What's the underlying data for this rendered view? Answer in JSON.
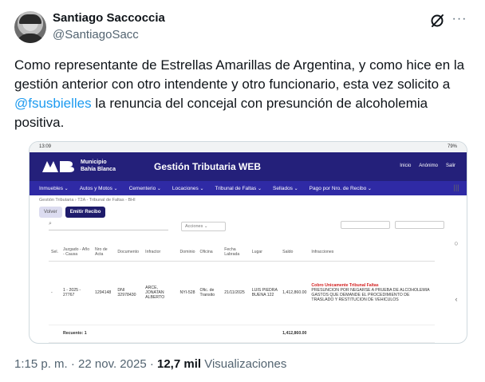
{
  "author": {
    "name": "Santiago Saccoccia",
    "handle": "@SantiagoSacc"
  },
  "tweet": {
    "text_before": "Como representante de Estrellas Amarillas de Argentina,  y como hice en la gestión anterior con otro intendente y otro funcionario, esta vez solicito a ",
    "mention": "@fsusbielles",
    "text_after": " la renuncia del concejal con presunción de alcoholemia positiva."
  },
  "media": {
    "status_time": "13:09",
    "status_right": "79%",
    "brand_line1": "Municipio",
    "brand_line2": "Bahía Blanca",
    "app_title": "Gestión Tributaria WEB",
    "actions": [
      "Inicio",
      "Anónimo",
      "Salir"
    ],
    "nav": [
      "Inmuebles",
      "Autos y Motos",
      "Cementerio",
      "Locaciones",
      "Tribunal de Faltas",
      "Sellados",
      "Pago por Nro. de Recibo"
    ],
    "breadcrumb": "Gestión Tributaria  ›  T2A - Tribunal de Faltas - BHI",
    "tab_ver": "Volver",
    "tab_emitir": "Emitir Recibo",
    "acciones_label": "Acciones",
    "columns": [
      "Sel.",
      "Juzgado - Año - Causa",
      "Nro de Acta",
      "Documento",
      "Infractor",
      "Dominio",
      "Oficina",
      "Fecha Labrada",
      "Lugar",
      "Saldo",
      "Infracciones"
    ],
    "row": {
      "sel": "-",
      "causa": "1 - 2025 - 27767",
      "acta": "1294148",
      "documento": "DNI 32978430",
      "infractor": "ARCE, JONATAN ALBERTO",
      "dominio": "NYI-528",
      "oficina": "Ofic. de Transito",
      "fecha": "21/11/2025",
      "lugar": "LUIS PIEDRA BUENA 122",
      "saldo": "1,412,860.00",
      "infraccion_header": "Cobro Unicamente Tribunal Faltas",
      "infraccion_text": "PRESUNCION POR NEGARSE A PRUEBA DE ALCOHOLEMIA GASTOS QUE DEMANDE EL PROCEDIMIENTO DE TRASLADO Y RESTITUCION DE VEHICULOS"
    },
    "total_label": "Recuento: 1",
    "total_saldo": "1,412,860.00"
  },
  "footer": {
    "time_date": "1:15 p. m. · 22 nov. 2025 · ",
    "views_count": "12,7 mil",
    "views_label": " Visualizaciones"
  }
}
